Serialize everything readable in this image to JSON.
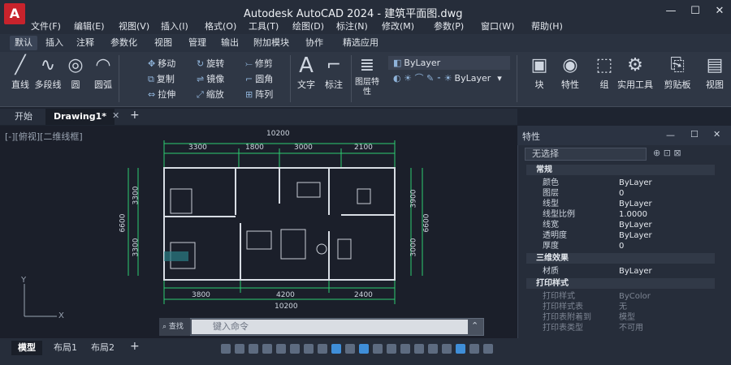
{
  "titlebar": {
    "title": "Autodesk AutoCAD 2024 - 建筑平面图.dwg",
    "logo": "A"
  },
  "menubar": [
    "文件(F)",
    "编辑(E)",
    "视图(V)",
    "插入(I)",
    "格式(O)",
    "工具(T)",
    "绘图(D)",
    "标注(N)",
    "修改(M)",
    "参数(P)",
    "窗口(W)",
    "帮助(H)"
  ],
  "ribbon_tabs": [
    "默认",
    "插入",
    "注释",
    "参数化",
    "视图",
    "管理",
    "输出",
    "附加模块",
    "协作",
    "精选应用"
  ],
  "ribbon": {
    "draw": [
      "直线",
      "多段线",
      "圆",
      "圆弧"
    ],
    "modify_rows": [
      [
        "移动",
        "旋转",
        "修剪"
      ],
      [
        "复制",
        "镜像",
        "圆角"
      ],
      [
        "拉伸",
        "缩放",
        "阵列"
      ]
    ],
    "annotation": [
      "文字",
      "标注"
    ],
    "layer_btn": "图层特性",
    "bylayer1": "ByLayer",
    "bylayer2": "ByLayer",
    "right_btns": [
      "块",
      "特性",
      "组",
      "实用工具",
      "剪贴板",
      "视图"
    ]
  },
  "doc_tabs": [
    "开始",
    "Drawing1*"
  ],
  "viewport": {
    "label": "[-][俯视][二维线框]"
  },
  "plan": {
    "total_top": "10200",
    "top": [
      "3300",
      "1800",
      "3000",
      "2100"
    ],
    "bottom": [
      "3800",
      "4200",
      "2400"
    ],
    "total_bottom": "10200",
    "left": [
      "3300",
      "3300"
    ],
    "left_total": "6600",
    "right": [
      "3900",
      "3000"
    ],
    "right_total": "6600"
  },
  "cmdline": {
    "history": "查找",
    "placeholder": "键入命令"
  },
  "status_tabs": [
    "模型",
    "布局1",
    "布局2"
  ],
  "properties": {
    "title": "特性",
    "selection": "无选择",
    "groups": [
      {
        "name": "常规",
        "rows": [
          [
            "颜色",
            "ByLayer"
          ],
          [
            "图层",
            "0"
          ],
          [
            "线型",
            "ByLayer"
          ],
          [
            "线型比例",
            "1.0000"
          ],
          [
            "线宽",
            "ByLayer"
          ],
          [
            "透明度",
            "ByLayer"
          ],
          [
            "厚度",
            "0"
          ]
        ]
      },
      {
        "name": "三维效果",
        "rows": [
          [
            "材质",
            "ByLayer"
          ]
        ]
      },
      {
        "name": "打印样式",
        "rows": [
          [
            "打印样式",
            "ByColor"
          ],
          [
            "打印样式表",
            "无"
          ],
          [
            "打印表附着到",
            "模型"
          ],
          [
            "打印表类型",
            "不可用"
          ]
        ]
      }
    ]
  },
  "colors": {
    "accent": "#3f8ed8",
    "wall": "#d8dde4",
    "dim": "#2ecc71",
    "logo": "#c8232c"
  }
}
